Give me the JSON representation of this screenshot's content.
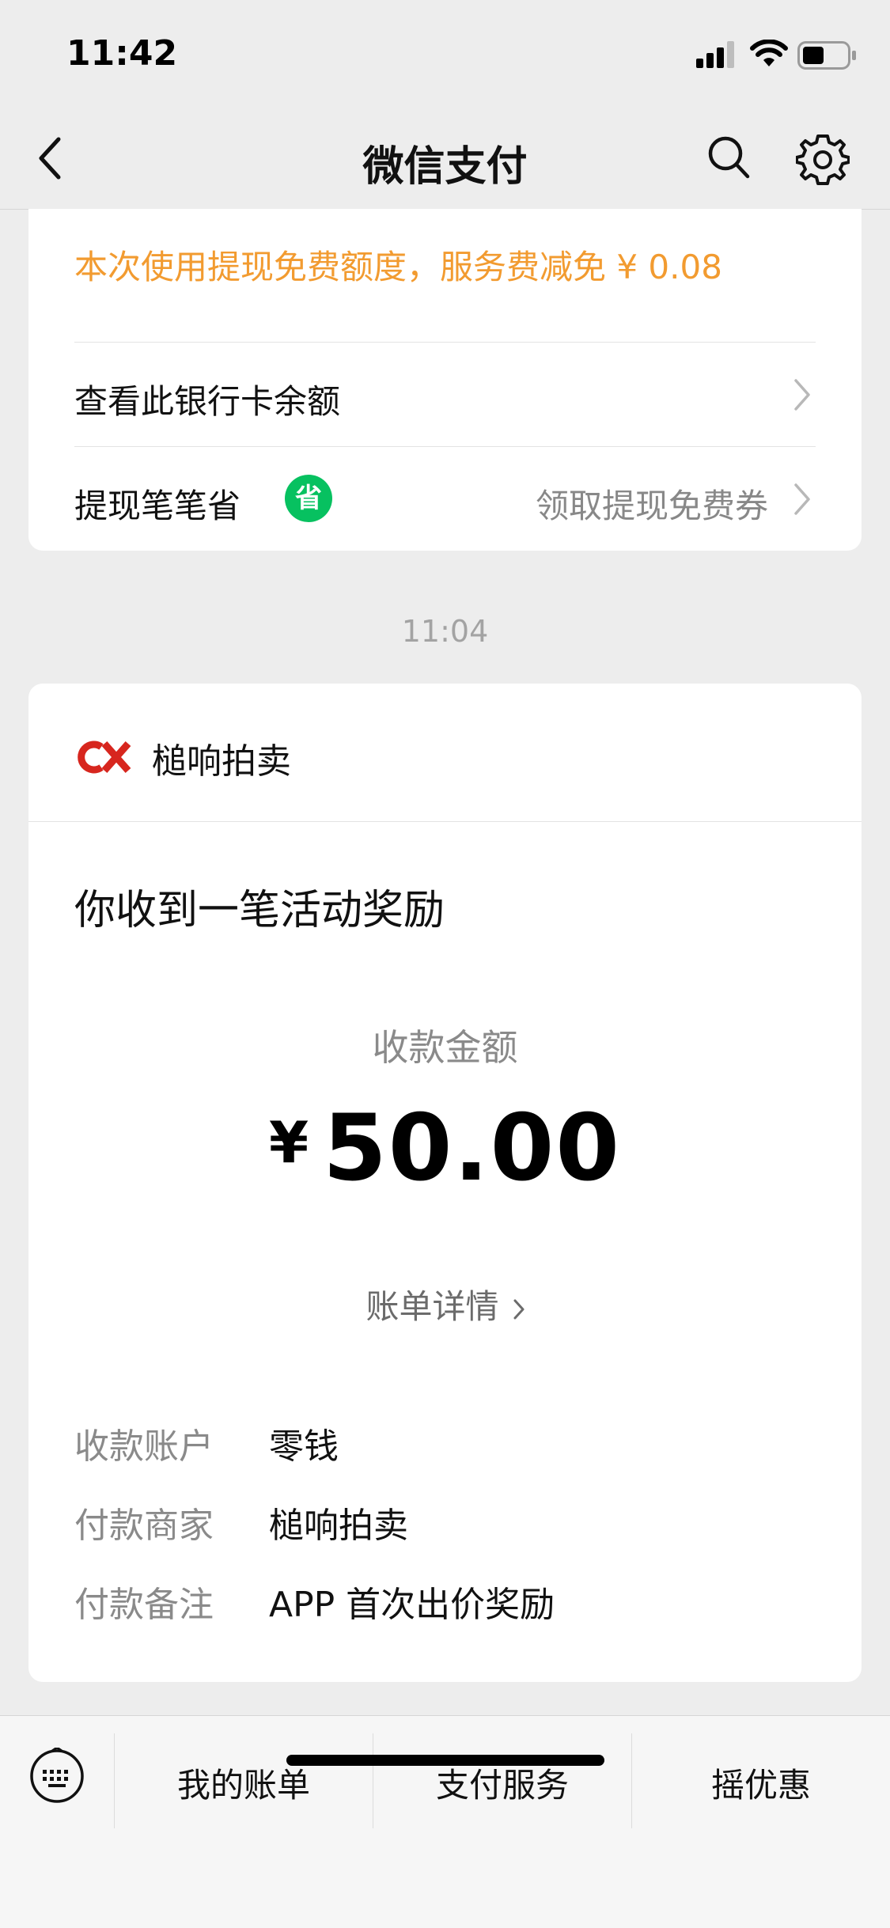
{
  "status_bar": {
    "time": "11:42"
  },
  "header": {
    "title": "微信支付"
  },
  "withdraw_card": {
    "fee_note": "本次使用提现免费额度，服务费减免 ¥ 0.08",
    "view_balance_label": "查看此银行卡余额",
    "save_label": "提现笔笔省",
    "save_badge": "省",
    "coupon_label": "领取提现免费券"
  },
  "timestamp": "11:04",
  "message_card": {
    "merchant": "槌响拍卖",
    "logo_text": "CX",
    "title": "你收到一笔活动奖励",
    "amount_label": "收款金额",
    "currency": "¥",
    "amount": "50.00",
    "detail_link": "账单详情",
    "details": [
      {
        "key": "收款账户",
        "value": "零钱"
      },
      {
        "key": "付款商家",
        "value": "槌响拍卖"
      },
      {
        "key": "付款备注",
        "value": "APP 首次出价奖励"
      }
    ]
  },
  "bottom_menu": {
    "items": [
      {
        "label": "我的账单"
      },
      {
        "label": "支付服务"
      },
      {
        "label": "摇优惠"
      }
    ]
  },
  "colors": {
    "accent_orange": "#f29b30",
    "badge_green": "#07c160",
    "logo_red": "#d7261e"
  }
}
